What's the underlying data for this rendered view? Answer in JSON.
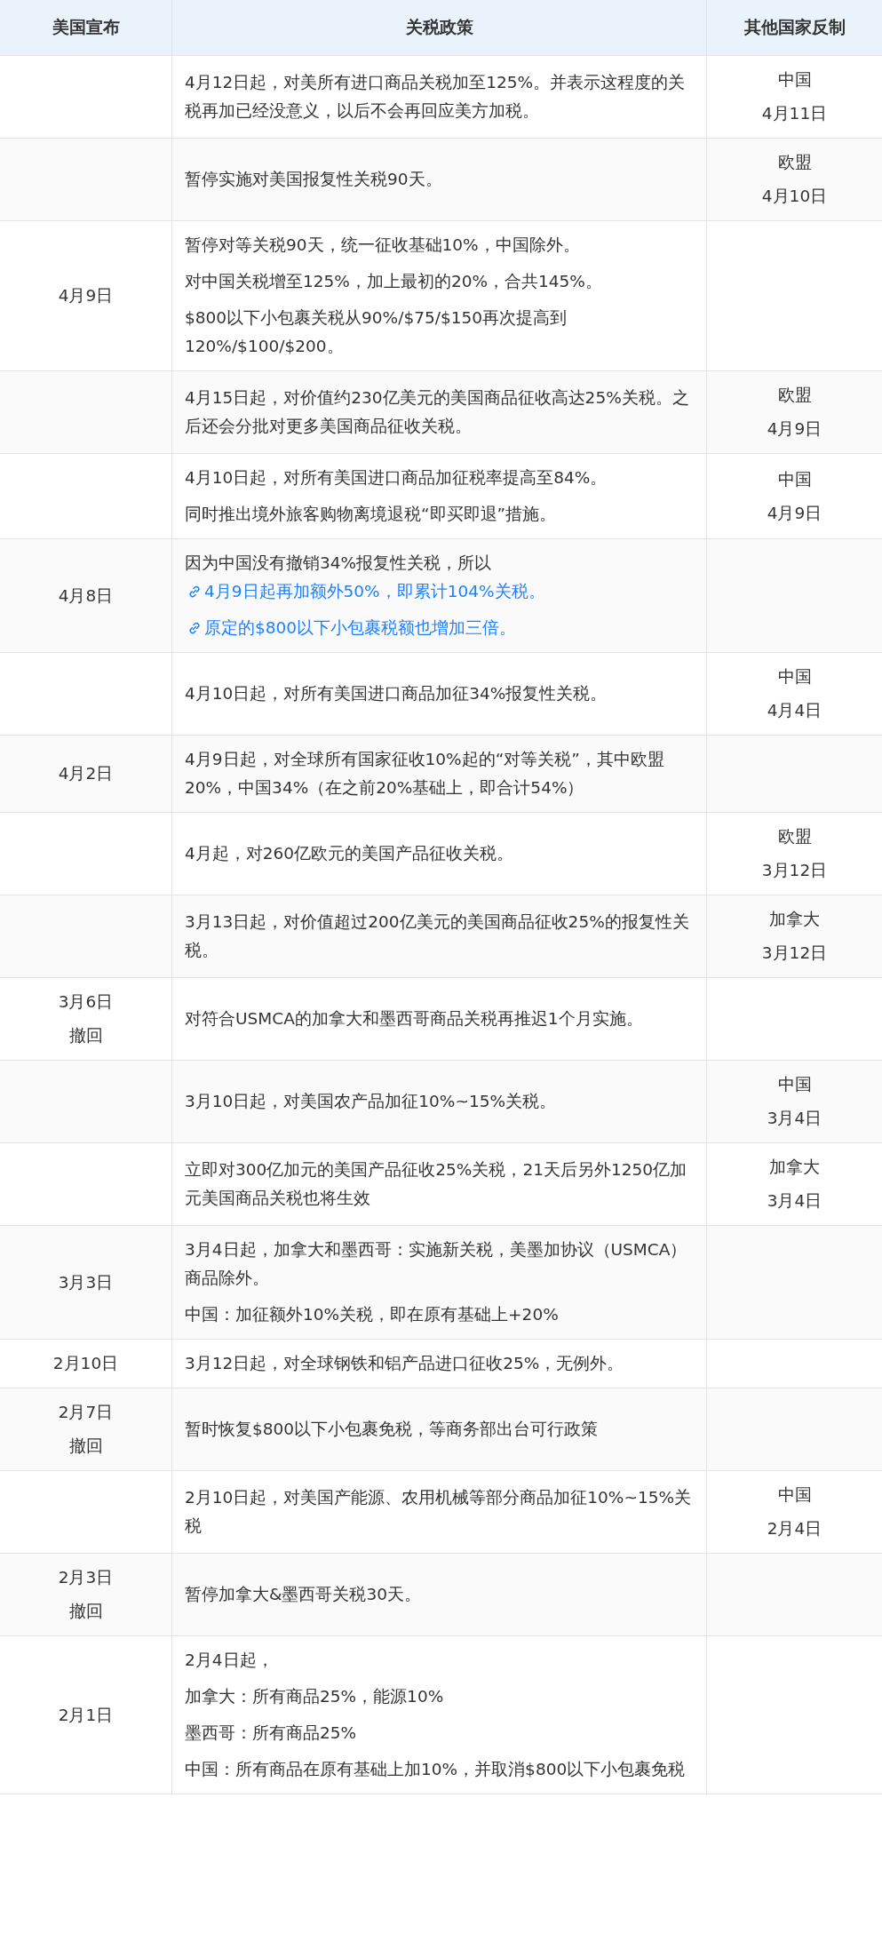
{
  "columns": [
    "美国宣布",
    "关税政策",
    "其他国家反制"
  ],
  "rows": [
    {
      "us": [],
      "policy": [
        {
          "text": "4月12日起，对美所有进口商品关税加至125%。并表示这程度的关税再加已经没意义，以后不会再回应美方加税。"
        }
      ],
      "counter": [
        "中国",
        "4月11日"
      ]
    },
    {
      "us": [],
      "policy": [
        {
          "text": "暂停实施对美国报复性关税90天。"
        }
      ],
      "counter": [
        "欧盟",
        "4月10日"
      ]
    },
    {
      "us": [
        "4月9日"
      ],
      "policy": [
        {
          "text": "暂停对等关税90天，统一征收基础10%，中国除外。"
        },
        {
          "text": "对中国关税增至125%，加上最初的20%，合共145%。"
        },
        {
          "text": "$800以下小包裹关税从90%/$75/$150再次提高到120%/$100/$200。"
        }
      ],
      "counter": []
    },
    {
      "us": [],
      "policy": [
        {
          "text": "4月15日起，对价值约230亿美元的美国商品征收高达25%关税。之后还会分批对更多美国商品征收关税。"
        }
      ],
      "counter": [
        "欧盟",
        "4月9日"
      ]
    },
    {
      "us": [],
      "policy": [
        {
          "text": "4月10日起，对所有美国进口商品加征税率提高至84%。"
        },
        {
          "text": "同时推出境外旅客购物离境退税“即买即退”措施。"
        }
      ],
      "counter": [
        "中国",
        "4月9日"
      ]
    },
    {
      "us": [
        "4月8日"
      ],
      "policy": [
        {
          "text": "因为中国没有撤销34%报复性关税，所以",
          "link": "4月9日起再加额外50%，即累计104%关税。"
        },
        {
          "link": "原定的$800以下小包裹税额也增加三倍。"
        }
      ],
      "counter": []
    },
    {
      "us": [],
      "policy": [
        {
          "text": "4月10日起，对所有美国进口商品加征34%报复性关税。"
        }
      ],
      "counter": [
        "中国",
        "4月4日"
      ]
    },
    {
      "us": [
        "4月2日"
      ],
      "policy": [
        {
          "text": "4月9日起，对全球所有国家征收10%起的“对等关税”，其中欧盟20%，中国34%（在之前20%基础上，即合计54%）"
        }
      ],
      "counter": []
    },
    {
      "us": [],
      "policy": [
        {
          "text": "4月起，对260亿欧元的美国产品征收关税。"
        }
      ],
      "counter": [
        "欧盟",
        "3月12日"
      ]
    },
    {
      "us": [],
      "policy": [
        {
          "text": "3月13日起，对价值超过200亿美元的美国商品征收25%的报复性关税。"
        }
      ],
      "counter": [
        "加拿大",
        "3月12日"
      ]
    },
    {
      "us": [
        "3月6日",
        "撤回"
      ],
      "policy": [
        {
          "text": "对符合USMCA的加拿大和墨西哥商品关税再推迟1个月实施。"
        }
      ],
      "counter": []
    },
    {
      "us": [],
      "policy": [
        {
          "text": "3月10日起，对美国农产品加征10%~15%关税。"
        }
      ],
      "counter": [
        "中国",
        "3月4日"
      ]
    },
    {
      "us": [],
      "policy": [
        {
          "text": "立即对300亿加元的美国产品征收25%关税，21天后另外1250亿加元美国商品关税也将生效"
        }
      ],
      "counter": [
        "加拿大",
        "3月4日"
      ]
    },
    {
      "us": [
        "3月3日"
      ],
      "policy": [
        {
          "text": "3月4日起，加拿大和墨西哥：实施新关税，美墨加协议（USMCA）商品除外。"
        },
        {
          "text": "中国：加征额外10%关税，即在原有基础上+20%"
        }
      ],
      "counter": []
    },
    {
      "us": [
        "2月10日"
      ],
      "policy": [
        {
          "text": "3月12日起，对全球钢铁和铝产品进口征收25%，无例外。"
        }
      ],
      "counter": []
    },
    {
      "us": [
        "2月7日",
        "撤回"
      ],
      "policy": [
        {
          "text": "暂时恢复$800以下小包裹免税，等商务部出台可行政策"
        }
      ],
      "counter": []
    },
    {
      "us": [],
      "policy": [
        {
          "text": "2月10日起，对美国产能源、农用机械等部分商品加征10%~15%关税"
        }
      ],
      "counter": [
        "中国",
        "2月4日"
      ]
    },
    {
      "us": [
        "2月3日",
        "撤回"
      ],
      "policy": [
        {
          "text": "暂停加拿大&墨西哥关税30天。"
        }
      ],
      "counter": []
    },
    {
      "us": [
        "2月1日"
      ],
      "policy": [
        {
          "text": "2月4日起，"
        },
        {
          "text": "加拿大：所有商品25%，能源10%"
        },
        {
          "text": "墨西哥：所有商品25%"
        },
        {
          "text": "中国：所有商品在原有基础上加10%，并取消$800以下小包裹免税"
        }
      ],
      "counter": []
    }
  ]
}
